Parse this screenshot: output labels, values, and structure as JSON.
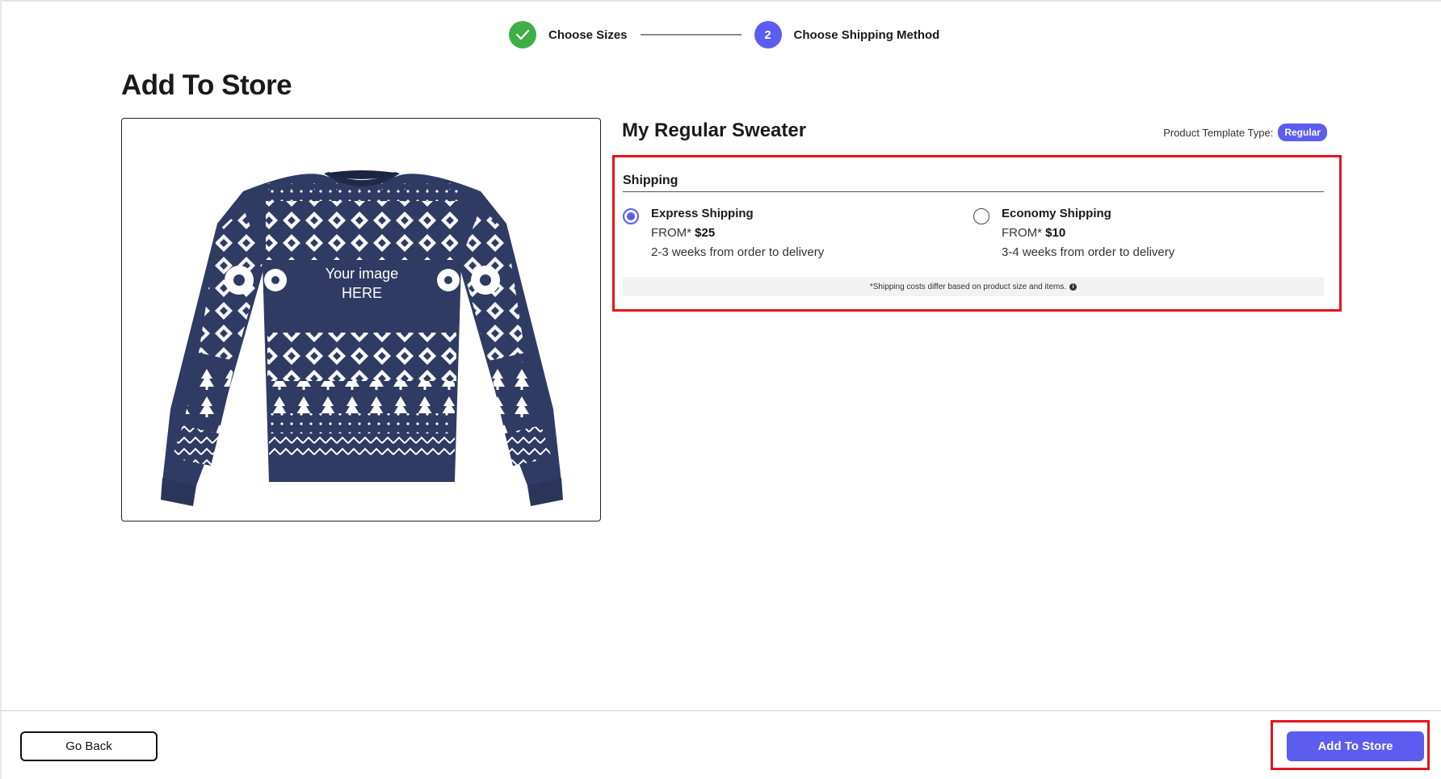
{
  "stepper": {
    "steps": [
      {
        "number": "✓",
        "label": "Choose Sizes",
        "status": "completed"
      },
      {
        "number": "2",
        "label": "Choose Shipping Method",
        "status": "active"
      }
    ]
  },
  "page": {
    "title": "Add To Store"
  },
  "product": {
    "name": "My Regular Sweater",
    "template_type_label": "Product Template Type:",
    "template_type": "Regular",
    "image_text_line1": "Your image",
    "image_text_line2": "HERE",
    "image_colors": {
      "primary": "#2f3b63",
      "pattern": "#ffffff"
    }
  },
  "shipping": {
    "heading": "Shipping",
    "options": [
      {
        "name": "Express Shipping",
        "from_label": "FROM*",
        "price": "$25",
        "eta": "2-3 weeks from order to delivery",
        "selected": true
      },
      {
        "name": "Economy Shipping",
        "from_label": "FROM*",
        "price": "$10",
        "eta": "3-4 weeks from order to delivery",
        "selected": false
      }
    ],
    "note": "*Shipping costs differ based on product size and items.",
    "note_icon": "info-icon"
  },
  "footer": {
    "back_label": "Go Back",
    "add_label": "Add To Store"
  },
  "colors": {
    "accent": "#5c5cf0",
    "success": "#3fae46",
    "highlight": "#e4141e"
  }
}
